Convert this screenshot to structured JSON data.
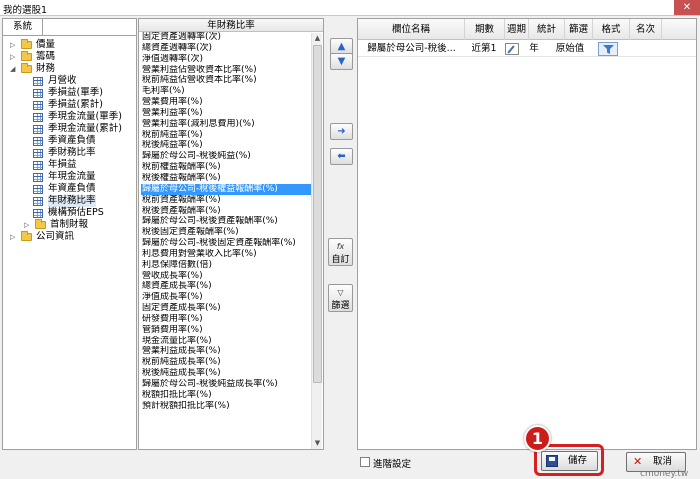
{
  "window": {
    "title": "我的選股1",
    "close": "✕"
  },
  "tree": {
    "tab": "系統",
    "items": [
      {
        "label": "價量",
        "level": 0,
        "arrow": "▷",
        "icon": "folder"
      },
      {
        "label": "籌碼",
        "level": 0,
        "arrow": "▷",
        "icon": "folder"
      },
      {
        "label": "財務",
        "level": 0,
        "arrow": "◢",
        "icon": "folder"
      },
      {
        "label": "月營收",
        "level": 1,
        "icon": "table"
      },
      {
        "label": "季損益(單季)",
        "level": 1,
        "icon": "table"
      },
      {
        "label": "季損益(累計)",
        "level": 1,
        "icon": "table"
      },
      {
        "label": "季現金流量(單季)",
        "level": 1,
        "icon": "table"
      },
      {
        "label": "季現金流量(累計)",
        "level": 1,
        "icon": "table"
      },
      {
        "label": "季資產負債",
        "level": 1,
        "icon": "table"
      },
      {
        "label": "季財務比率",
        "level": 1,
        "icon": "table"
      },
      {
        "label": "年損益",
        "level": 1,
        "icon": "table"
      },
      {
        "label": "年現金流量",
        "level": 1,
        "icon": "table"
      },
      {
        "label": "年資產負債",
        "level": 1,
        "icon": "table"
      },
      {
        "label": "年財務比率",
        "level": 1,
        "icon": "table",
        "selected": true
      },
      {
        "label": "機構預估EPS",
        "level": 1,
        "icon": "table"
      },
      {
        "label": "首制財報",
        "level": 1,
        "arrow": "▷",
        "icon": "folder"
      },
      {
        "label": "公司資訊",
        "level": 0,
        "arrow": "▷",
        "icon": "folder"
      }
    ]
  },
  "list": {
    "header": "年財務比率",
    "items": [
      "固定資產週轉率(次)",
      "總資產週轉率(次)",
      "淨值週轉率(次)",
      "營業利益佔營收資本比率(%)",
      "稅前純益佔營收資本比率(%)",
      "毛利率(%)",
      "營業費用率(%)",
      "營業利益率(%)",
      "營業利益率(減利息費用)(%)",
      "稅前純益率(%)",
      "稅後純益率(%)",
      "歸屬於母公司-稅後純益(%)",
      "稅前權益報酬率(%)",
      "稅後權益報酬率(%)",
      "歸屬於母公司-稅後權益報酬率(%)",
      "稅前資產報酬率(%)",
      "稅後資產報酬率(%)",
      "歸屬於母公司-稅後資產報酬率(%)",
      "稅後固定資產報酬率(%)",
      "歸屬於母公司-稅後固定資產報酬率(%)",
      "利息費用對營業收入比率(%)",
      "利息保障倍數(倍)",
      "營收成長率(%)",
      "總資產成長率(%)",
      "淨值成長率(%)",
      "固定資產成長率(%)",
      "研發費用率(%)",
      "管銷費用率(%)",
      "現金流量比率(%)",
      "營業利益成長率(%)",
      "稅前純益成長率(%)",
      "稅後純益成長率(%)",
      "歸屬於母公司-稅後純益成長率(%)",
      "稅額扣抵比率(%)",
      "預計稅額扣抵比率(%)"
    ],
    "selected_index": 14
  },
  "middle_buttons": {
    "move_up": "▲",
    "move_down": "▼",
    "add": "➜",
    "remove": "⬅",
    "custom_icon": "fx",
    "custom_label": "自訂",
    "filter_icon": "▽",
    "filter_label": "篩選"
  },
  "grid": {
    "columns": [
      "欄位名稱",
      "期數",
      "週期",
      "統計",
      "篩選",
      "格式",
      "名次"
    ],
    "rows": [
      {
        "name": "歸屬於母公司-稅後...",
        "period": "近第1",
        "cycle": "年",
        "stat": "原始值",
        "filter": "",
        "format": "",
        "rank": ""
      }
    ]
  },
  "bottom": {
    "advanced_label": "進階設定",
    "save_label": "儲存",
    "cancel_label": "取消",
    "step_badge": "1",
    "watermark": "cmoney.tw"
  },
  "colors": {
    "selection": "#3399ff",
    "highlight": "#d42020",
    "badge": "#cc1d1d",
    "folder": "#f3c84a"
  }
}
